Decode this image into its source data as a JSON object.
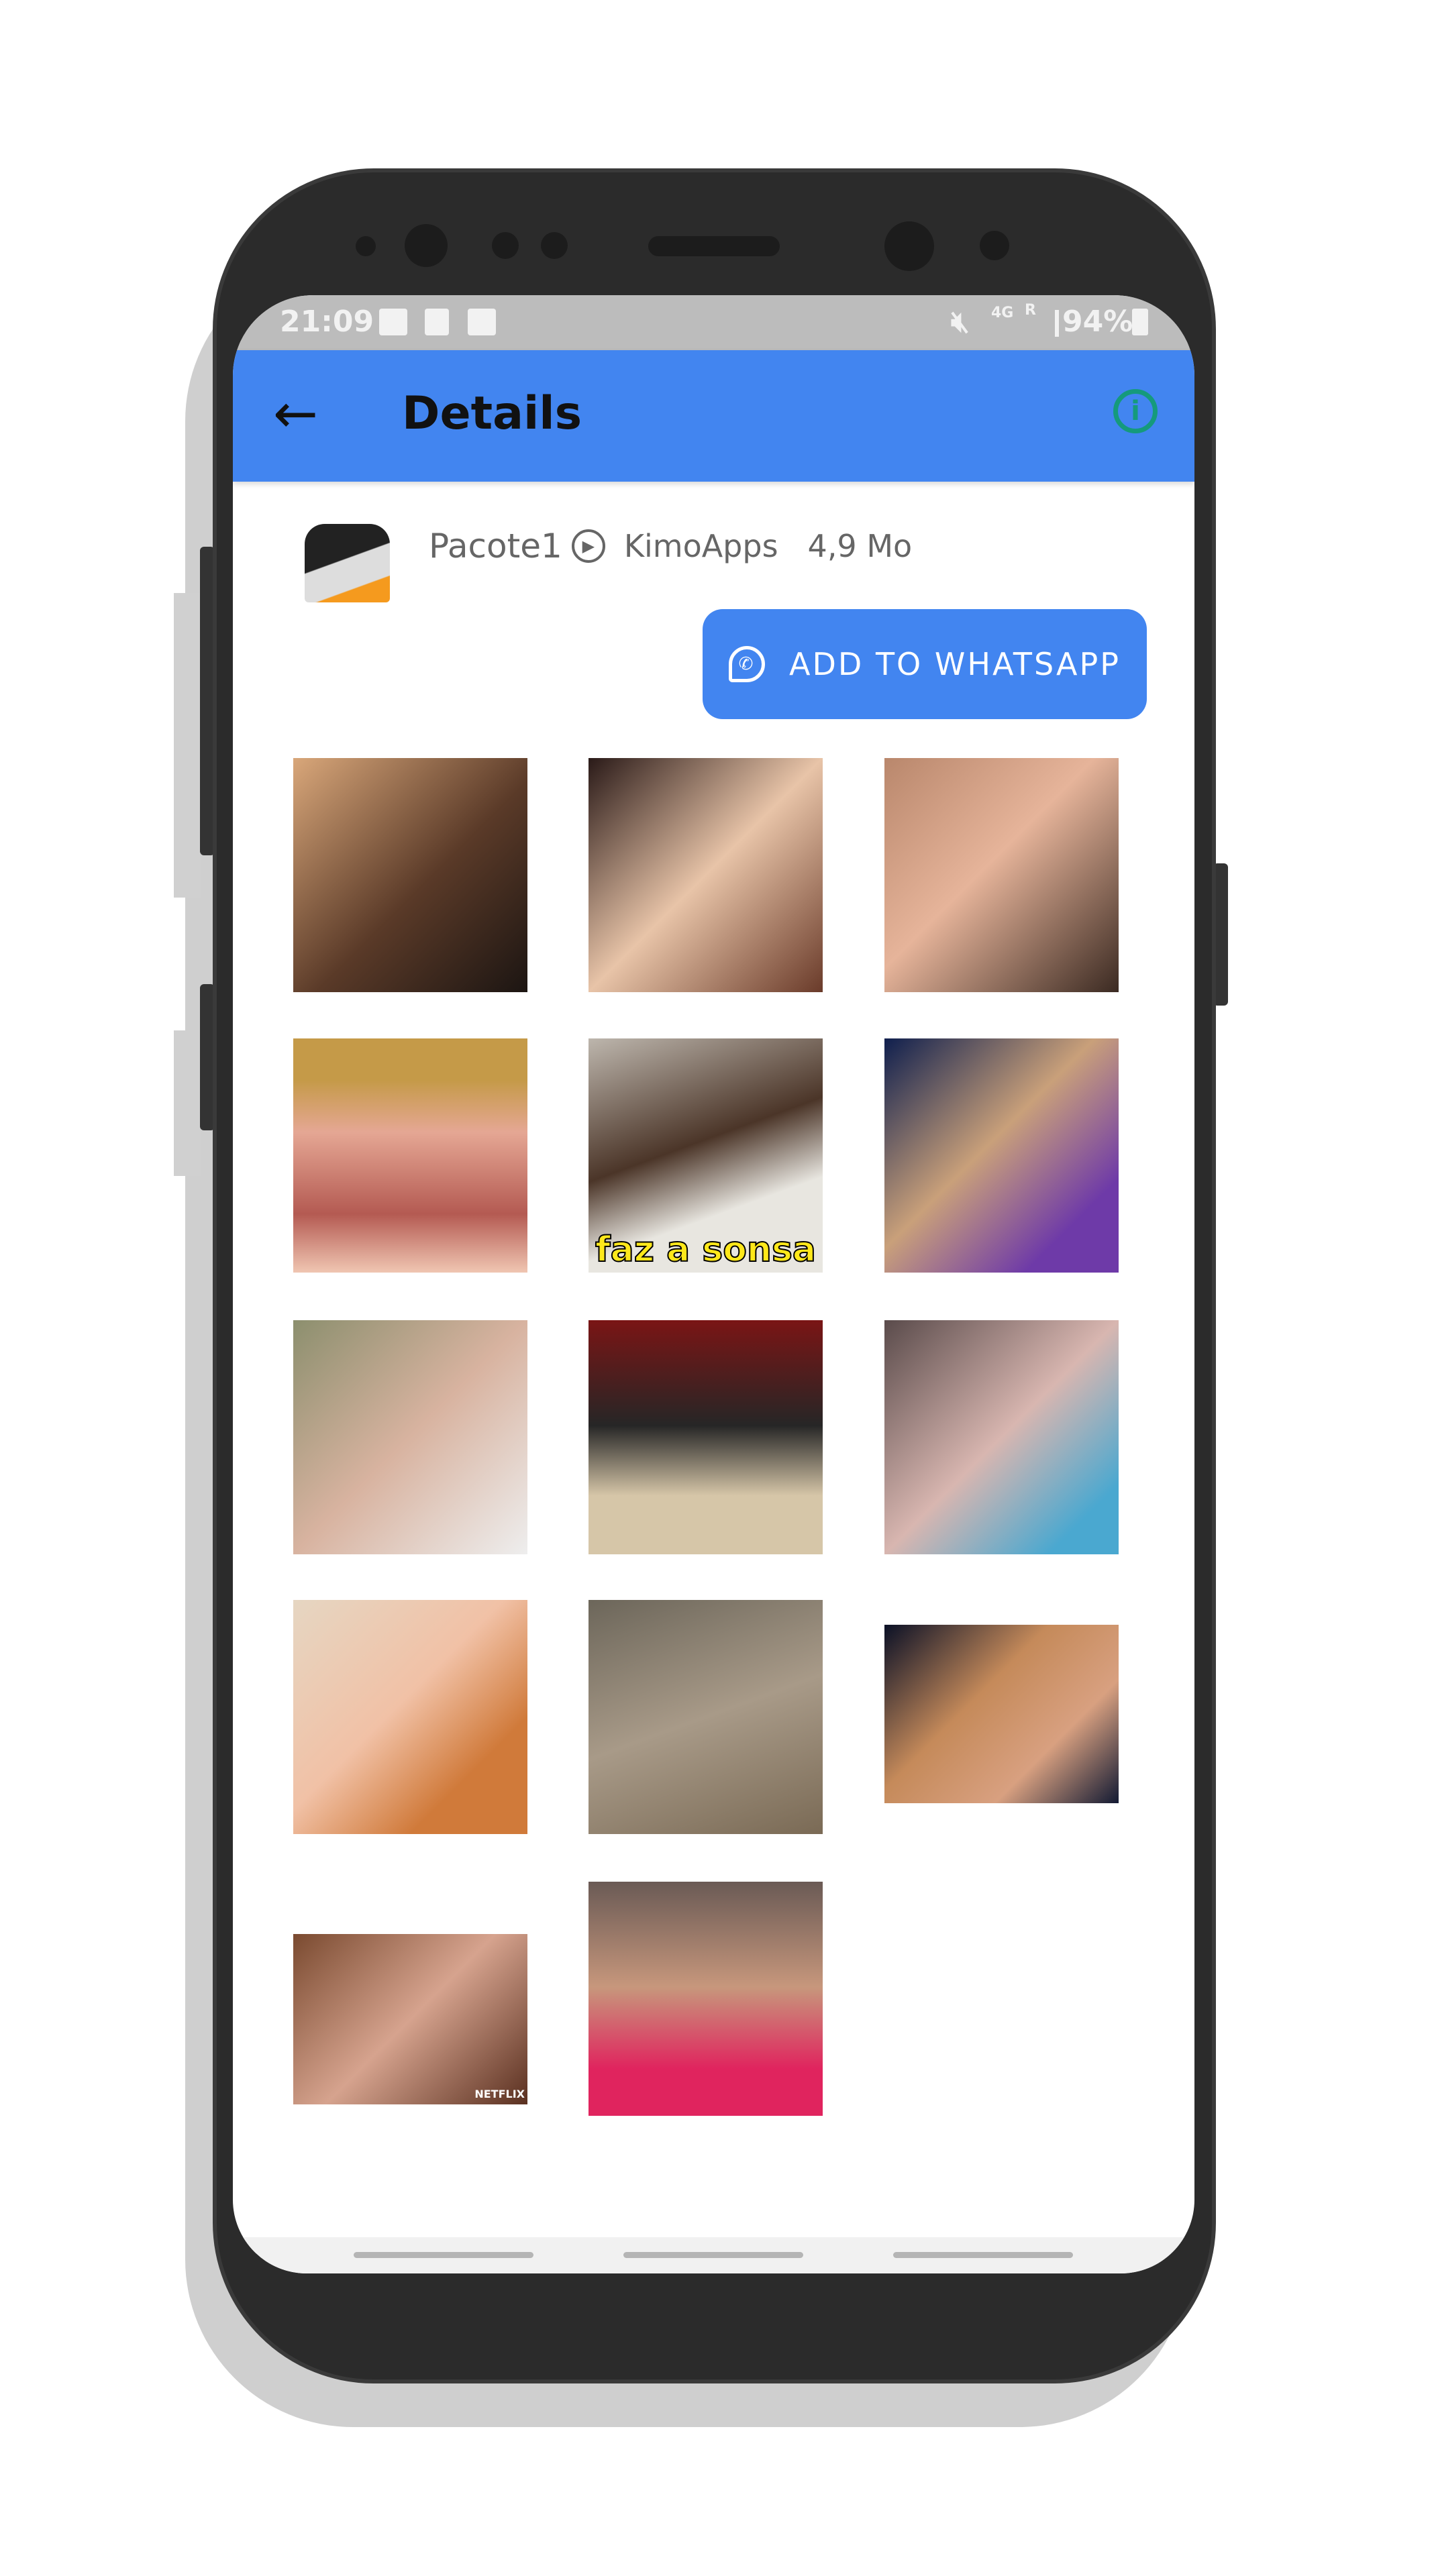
{
  "status_bar": {
    "time": "21:09",
    "battery": "94%",
    "network": "4G",
    "roaming": "R"
  },
  "app_bar": {
    "title": "Details",
    "back_icon": "arrow-left-icon",
    "info_icon": "info-circle-icon",
    "info_color": "#159a7c"
  },
  "pack": {
    "name": "Pacote1",
    "animated_icon": "play-circle-icon",
    "publisher": "KimoApps",
    "size": "4,9 Mo"
  },
  "add_button": {
    "label": "ADD TO WHATSAPP",
    "icon": "whatsapp-icon"
  },
  "colors": {
    "accent": "#4285f0",
    "status_bar": "#bcbcbc"
  },
  "stickers": [
    {
      "caption": "",
      "watermark": ""
    },
    {
      "caption": "",
      "watermark": ""
    },
    {
      "caption": "",
      "watermark": ""
    },
    {
      "caption": "",
      "watermark": ""
    },
    {
      "caption": "faz a sonsa",
      "watermark": ""
    },
    {
      "caption": "",
      "watermark": ""
    },
    {
      "caption": "",
      "watermark": ""
    },
    {
      "caption": "",
      "watermark": ""
    },
    {
      "caption": "",
      "watermark": ""
    },
    {
      "caption": "",
      "watermark": ""
    },
    {
      "caption": "",
      "watermark": ""
    },
    {
      "caption": "",
      "watermark": ""
    },
    {
      "caption": "",
      "watermark": "NETFLIX"
    },
    {
      "caption": "",
      "watermark": ""
    }
  ]
}
